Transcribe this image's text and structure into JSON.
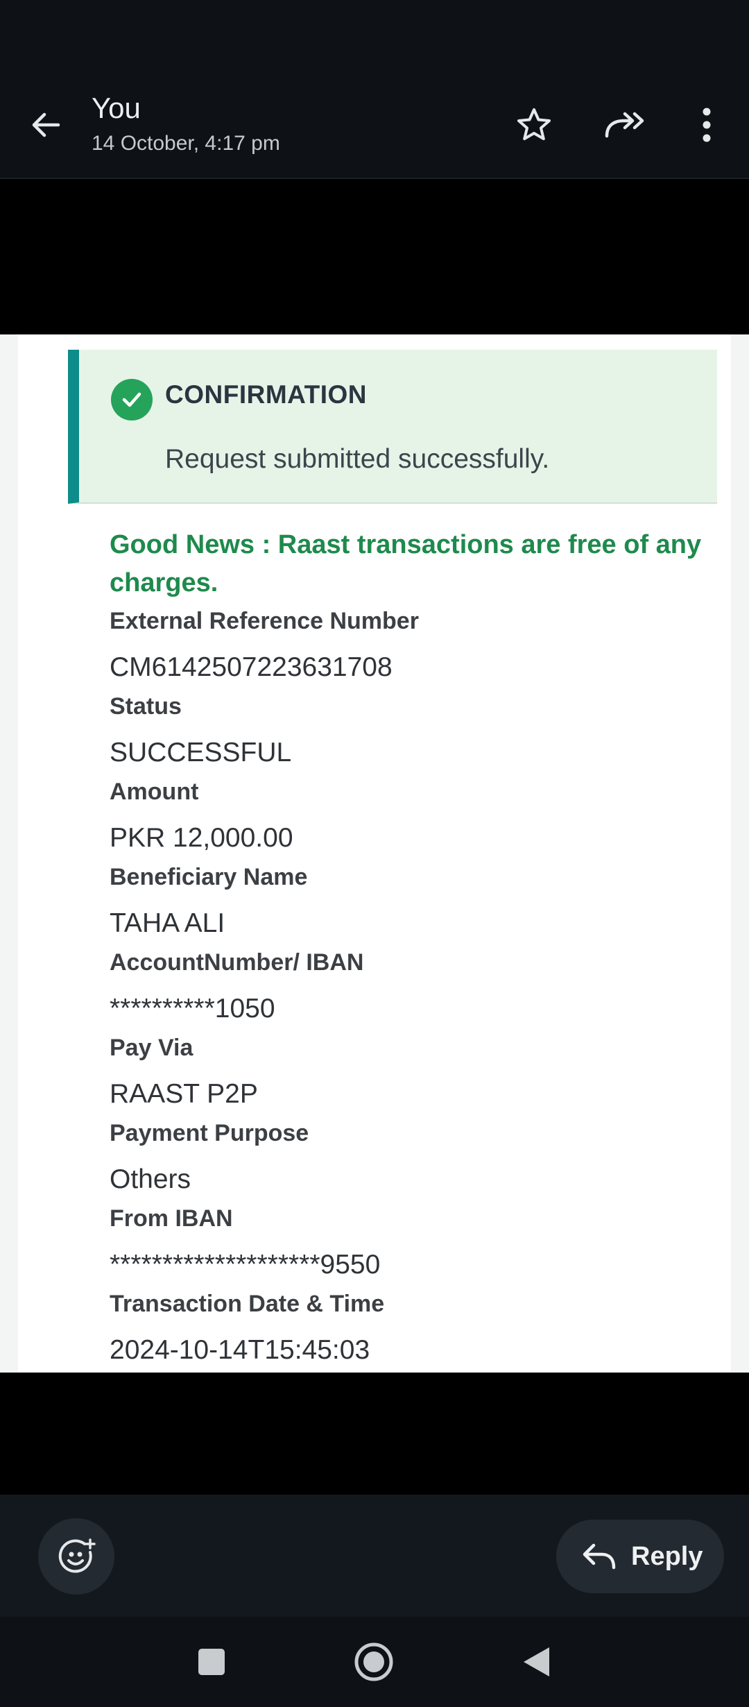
{
  "header": {
    "sender": "You",
    "datetime": "14 October, 4:17 pm",
    "icons": {
      "back": "arrow-left-icon",
      "star": "star-outline-icon",
      "forward": "forward-all-icon",
      "more": "more-vertical-icon"
    }
  },
  "receipt": {
    "confirmation": {
      "title": "CONFIRMATION",
      "message": "Request submitted successfully.",
      "icon": "check-circle-icon"
    },
    "good_news": "Good News : Raast transactions are free of any charges.",
    "fields": [
      {
        "label": "External Reference Number",
        "value": "CM6142507223631708"
      },
      {
        "label": "Status",
        "value": "SUCCESSFUL"
      },
      {
        "label": "Amount",
        "value": "PKR 12,000.00"
      },
      {
        "label": "Beneficiary Name",
        "value": "TAHA ALI"
      },
      {
        "label": "AccountNumber/ IBAN",
        "value": "**********1050"
      },
      {
        "label": "Pay Via",
        "value": "RAAST P2P"
      },
      {
        "label": "Payment Purpose",
        "value": "Others"
      },
      {
        "label": "From IBAN",
        "value": "********************9550"
      },
      {
        "label": "Transaction Date & Time",
        "value": "2024-10-14T15:45:03"
      }
    ]
  },
  "bottom": {
    "reply_label": "Reply",
    "icons": {
      "emoji": "add-reaction-icon",
      "reply": "reply-icon"
    }
  },
  "system_nav": {
    "icons": [
      "recents-square-icon",
      "home-circle-icon",
      "back-triangle-icon"
    ]
  },
  "colors": {
    "background": "#0e1216",
    "confirm_bg": "#e6f4e8",
    "confirm_accent": "#0e8c8a",
    "success_green": "#25a35a",
    "good_news_green": "#1e8a4c"
  }
}
